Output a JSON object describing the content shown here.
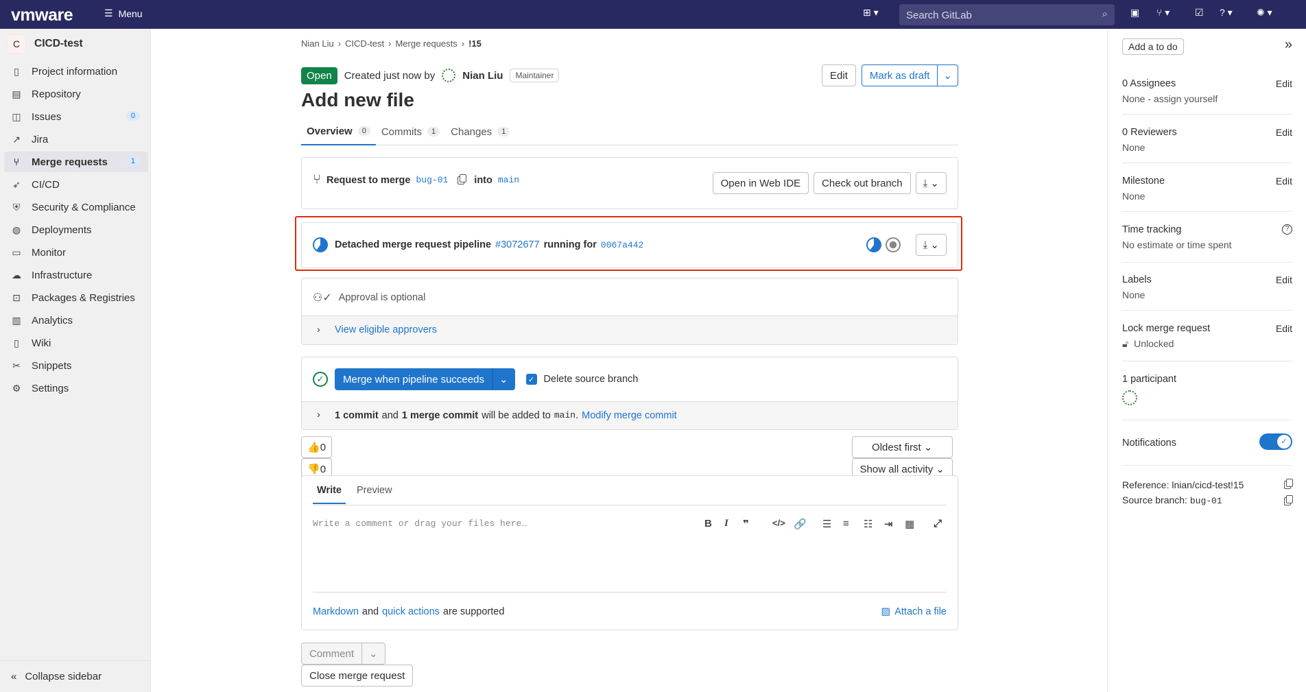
{
  "topbar": {
    "logo": "vmware",
    "menu_label": "Menu",
    "search_placeholder": "Search GitLab"
  },
  "sidebar": {
    "project_initial": "C",
    "project_name": "CICD-test",
    "items": [
      {
        "label": "Project information",
        "icon": "document-icon"
      },
      {
        "label": "Repository",
        "icon": "book-icon"
      },
      {
        "label": "Issues",
        "icon": "issues-icon",
        "badge": "0"
      },
      {
        "label": "Jira",
        "icon": "external-link-icon"
      },
      {
        "label": "Merge requests",
        "icon": "merge-request-icon",
        "badge": "1",
        "active": true
      },
      {
        "label": "CI/CD",
        "icon": "rocket-icon"
      },
      {
        "label": "Security & Compliance",
        "icon": "shield-icon"
      },
      {
        "label": "Deployments",
        "icon": "deployments-icon"
      },
      {
        "label": "Monitor",
        "icon": "monitor-icon"
      },
      {
        "label": "Infrastructure",
        "icon": "cloud-icon"
      },
      {
        "label": "Packages & Registries",
        "icon": "package-icon"
      },
      {
        "label": "Analytics",
        "icon": "chart-icon"
      },
      {
        "label": "Wiki",
        "icon": "book-icon"
      },
      {
        "label": "Snippets",
        "icon": "scissors-icon"
      },
      {
        "label": "Settings",
        "icon": "gear-icon"
      }
    ],
    "collapse_label": "Collapse sidebar"
  },
  "breadcrumb": [
    "Nian Liu",
    "CICD-test",
    "Merge requests",
    "!15"
  ],
  "header": {
    "status": "Open",
    "created": "Created just now by",
    "author": "Nian Liu",
    "role": "Maintainer",
    "edit_label": "Edit",
    "draft_label": "Mark as draft"
  },
  "title": "Add new file",
  "tabs": [
    {
      "label": "Overview",
      "count": "0"
    },
    {
      "label": "Commits",
      "count": "1"
    },
    {
      "label": "Changes",
      "count": "1"
    }
  ],
  "request": {
    "prefix": "Request to merge",
    "source": "bug-01",
    "into": "into",
    "target": "main",
    "web_ide": "Open in Web IDE",
    "checkout": "Check out branch"
  },
  "pipeline": {
    "prefix": "Detached merge request pipeline",
    "id": "#3072677",
    "running": "running for",
    "commit": "0067a442"
  },
  "approval": {
    "text": "Approval is optional",
    "view": "View eligible approvers"
  },
  "merge": {
    "button": "Merge when pipeline succeeds",
    "delete_source": "Delete source branch",
    "commits_a": "1 commit",
    "and": "and",
    "commits_b": "1 merge commit",
    "added": "will be added to",
    "branch": "main",
    "modify": "Modify merge commit"
  },
  "reactions": {
    "thumbs_up": "0",
    "thumbs_down": "0"
  },
  "sort": {
    "order": "Oldest first",
    "filter": "Show all activity"
  },
  "editor": {
    "write": "Write",
    "preview": "Preview",
    "placeholder": "Write a comment or drag your files here…",
    "markdown": "Markdown",
    "and": "and",
    "quick": "quick actions",
    "supported": "are supported",
    "attach": "Attach a file"
  },
  "actions": {
    "comment": "Comment",
    "close": "Close merge request"
  },
  "right": {
    "todo": "Add a to do",
    "assignees_title": "0 Assignees",
    "assignees_value": "None - assign yourself",
    "reviewers_title": "0 Reviewers",
    "reviewers_value": "None",
    "milestone_title": "Milestone",
    "milestone_value": "None",
    "time_title": "Time tracking",
    "time_value": "No estimate or time spent",
    "labels_title": "Labels",
    "labels_value": "None",
    "lock_title": "Lock merge request",
    "lock_value": "Unlocked",
    "participants": "1 participant",
    "notifications": "Notifications",
    "edit": "Edit",
    "reference": "Reference: lnian/cicd-test!15",
    "source_branch_label": "Source branch:",
    "source_branch": "bug-01"
  },
  "colors": {
    "topbar": "#292961",
    "accent": "#1f75cb",
    "open": "#108548",
    "highlight": "#dd2b0e"
  }
}
